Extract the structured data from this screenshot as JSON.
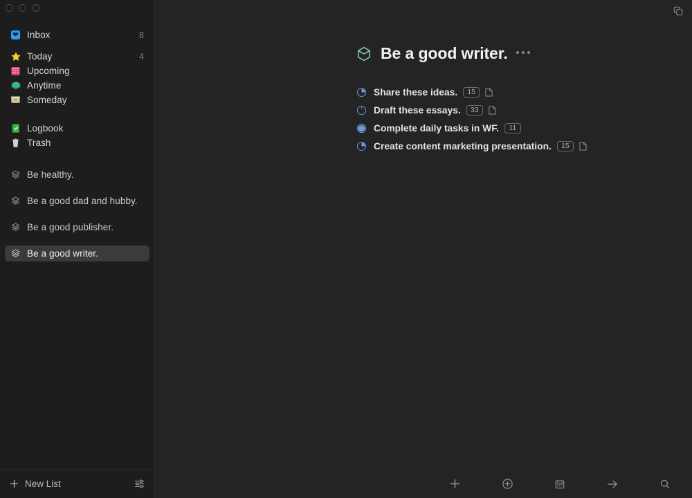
{
  "window": {
    "traffic_lights": [
      "close",
      "minimize",
      "zoom"
    ],
    "top_right_icon": "window-stack-icon"
  },
  "sidebar": {
    "nav": [
      {
        "id": "inbox",
        "label": "Inbox",
        "icon": "inbox-tray-icon",
        "count": "8"
      },
      {
        "id": "today",
        "label": "Today",
        "icon": "star-icon",
        "count": "4"
      },
      {
        "id": "upcoming",
        "label": "Upcoming",
        "icon": "calendar-icon",
        "count": ""
      },
      {
        "id": "anytime",
        "label": "Anytime",
        "icon": "layers-icon",
        "count": ""
      },
      {
        "id": "someday",
        "label": "Someday",
        "icon": "archive-box-icon",
        "count": ""
      },
      {
        "id": "logbook",
        "label": "Logbook",
        "icon": "logbook-icon",
        "count": ""
      },
      {
        "id": "trash",
        "label": "Trash",
        "icon": "trash-icon",
        "count": ""
      }
    ],
    "areas": [
      {
        "id": "be-healthy",
        "label": "Be healthy.",
        "icon": "area-stack-icon",
        "selected": false
      },
      {
        "id": "be-a-good-dad",
        "label": "Be a good dad and hubby.",
        "icon": "area-stack-icon",
        "selected": false
      },
      {
        "id": "be-a-good-publisher",
        "label": "Be a good publisher.",
        "icon": "area-stack-icon",
        "selected": false
      },
      {
        "id": "be-a-good-writer",
        "label": "Be a good writer.",
        "icon": "area-stack-icon",
        "selected": true
      }
    ],
    "footer": {
      "new_list_label": "New List",
      "new_list_icon": "plus-icon",
      "settings_icon": "sliders-icon"
    }
  },
  "main": {
    "project": {
      "icon": "project-hexagon-icon",
      "title": "Be a good writer.",
      "more_icon": "ellipsis-icon"
    },
    "tasks": [
      {
        "id": "share-these-ideas",
        "title": "Share these ideas.",
        "progress": 26,
        "badge": "15",
        "has_note": true
      },
      {
        "id": "draft-these-essays",
        "title": "Draft these essays.",
        "progress": 4,
        "badge": "33",
        "has_note": true
      },
      {
        "id": "complete-daily-wf",
        "title": "Complete daily tasks in WF.",
        "progress": 95,
        "badge": "11",
        "has_note": false
      },
      {
        "id": "create-content-mkt",
        "title": "Create content marketing presentation.",
        "progress": 26,
        "badge": "15",
        "has_note": true
      }
    ]
  },
  "bottom_bar": {
    "buttons": [
      {
        "id": "new-todo",
        "icon": "plus-icon"
      },
      {
        "id": "new-heading",
        "icon": "circle-plus-icon"
      },
      {
        "id": "when",
        "icon": "calendar-icon"
      },
      {
        "id": "move",
        "icon": "arrow-right-icon"
      },
      {
        "id": "search",
        "icon": "search-icon"
      }
    ]
  },
  "colors": {
    "sidebar_bg": "#1d1d1d",
    "main_bg": "#242424",
    "selection": "#3b3b3b",
    "accent_blue": "#4a90e2",
    "project_teal": "#7fbfa8",
    "inbox_blue": "#2f9cf4",
    "star_yellow": "#f7cf2e",
    "calendar_pink": "#e8437a",
    "anytime_teal": "#3fb8a0",
    "someday_tan": "#d9c9a3",
    "logbook_green": "#3cb44a"
  }
}
